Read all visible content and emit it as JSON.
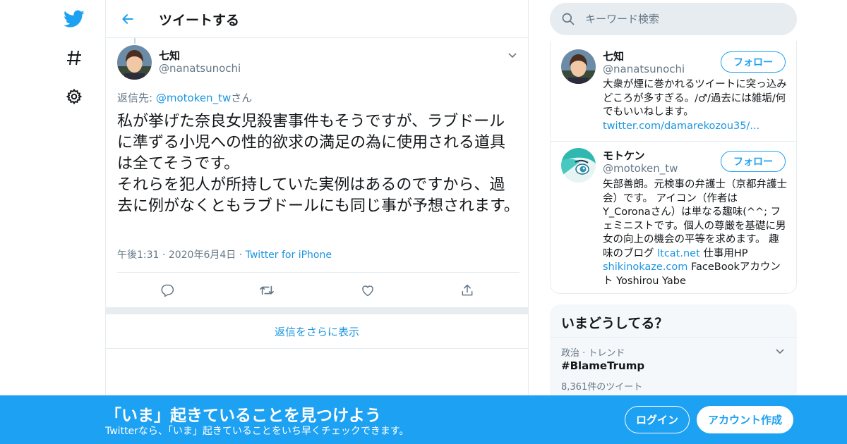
{
  "header": {
    "title": "ツイートする"
  },
  "tweet": {
    "author_name": "七知",
    "author_handle": "@nanatsunochi",
    "reply_prefix": "返信先: ",
    "reply_to": "@motoken_tw",
    "reply_suffix": "さん",
    "text": "私が挙げた奈良女児殺害事件もそうですが、ラブドールに準ずる小児への性的欲求の満足の為に使用される道具は全てそうです。\nそれらを犯人が所持していた実例はあるのですから、過去に例がなくともラブドールにも同じ事が予想されます。",
    "time": "午後1:31",
    "date": "2020年6月4日",
    "separator": "·",
    "source": "Twitter for iPhone"
  },
  "more_replies": "返信をさらに表示",
  "search": {
    "placeholder": "キーワード検索"
  },
  "users": [
    {
      "name": "七知",
      "handle": "@nanatsunochi",
      "follow_label": "フォロー",
      "bio_text": "大衆が煙に巻かれるツイートに突っ込みどころが多すぎる。/♂/過去には雑垢/何でもいいねします。",
      "bio_link": "twitter.com/damarekozou35/..."
    },
    {
      "name": "モトケン",
      "handle": "@motoken_tw",
      "follow_label": "フォロー",
      "bio_part1": "矢部善朗。元検事の弁護士（京都弁護士会）です。 アイコン（作者は Y_Coronaさん）は単なる趣味(^^; フェミニストです。個人の尊厳を基礎に男女の向上の機会の平等を求めます。 趣味のブログ ",
      "bio_link1": "ltcat.net",
      "bio_part2": " 仕事用HP ",
      "bio_link2": "shikinokaze.com",
      "bio_part3": " FaceBookアカウント Yoshirou Yabe"
    }
  ],
  "trends": {
    "title": "いまどうしてる？",
    "items": [
      {
        "category": "政治 · トレンド",
        "name": "#BlameTrump",
        "count": "8,361件のツイート"
      }
    ]
  },
  "bottom_bar": {
    "headline": "「いま」起きていることを見つけよう",
    "subtext": "Twitterなら、「いま」起きていることをいち早くチェックできます。",
    "login_label": "ログイン",
    "signup_label": "アカウント作成"
  },
  "colors": {
    "accent": "#1da1f2",
    "link": "#1b95e0",
    "muted": "#657786",
    "border": "#e6ecf0"
  },
  "icons": [
    "twitter-bird-icon",
    "hashtag-icon",
    "gear-icon",
    "back-arrow-icon",
    "chevron-down-icon",
    "reply-icon",
    "retweet-icon",
    "like-icon",
    "share-icon",
    "search-icon"
  ]
}
